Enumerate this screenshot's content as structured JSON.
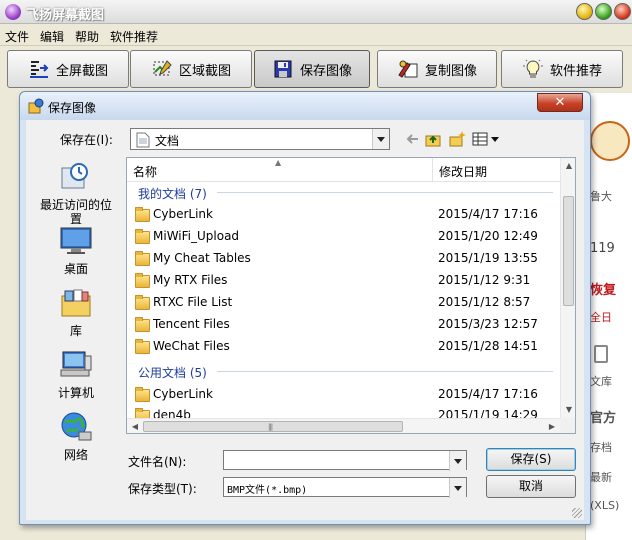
{
  "app": {
    "title": "飞扬屏幕截图",
    "menu": [
      "文件",
      "编辑",
      "帮助",
      "软件推荐"
    ],
    "toolbar": [
      "全屏截图",
      "区域截图",
      "保存图像",
      "复制图像",
      "软件推荐"
    ],
    "background_fragments": [
      "119",
      "恢复",
      "全日",
      "文库",
      "官方",
      "存档",
      "最新",
      "(XLS)",
      "鲁大"
    ]
  },
  "dialog": {
    "title": "保存图像",
    "close_label": "✕",
    "save_in_label": "保存在(I):",
    "save_in_value": "文档",
    "places": [
      "最近访问的位置",
      "桌面",
      "库",
      "计算机",
      "网络"
    ],
    "columns": {
      "name": "名称",
      "date": "修改日期"
    },
    "groups": [
      {
        "title": "我的文档 (7)",
        "items": [
          {
            "name": "CyberLink",
            "date": "2015/4/17 17:16"
          },
          {
            "name": "MiWiFi_Upload",
            "date": "2015/1/20 12:49"
          },
          {
            "name": "My Cheat Tables",
            "date": "2015/1/19 13:55"
          },
          {
            "name": "My RTX Files",
            "date": "2015/1/12 9:31"
          },
          {
            "name": "RTXC File List",
            "date": "2015/1/12 8:57"
          },
          {
            "name": "Tencent Files",
            "date": "2015/3/23 12:57"
          },
          {
            "name": "WeChat Files",
            "date": "2015/1/28 14:51"
          }
        ]
      },
      {
        "title": "公用文档 (5)",
        "items": [
          {
            "name": "CyberLink",
            "date": "2015/4/17 17:16"
          },
          {
            "name": "den4b",
            "date": "2015/1/19 14:29"
          }
        ]
      }
    ],
    "filename_label": "文件名(N):",
    "filename_value": "",
    "filetype_label": "保存类型(T):",
    "filetype_value": "BMP文件(*.bmp)",
    "save_button": "保存(S)",
    "cancel_button": "取消"
  }
}
